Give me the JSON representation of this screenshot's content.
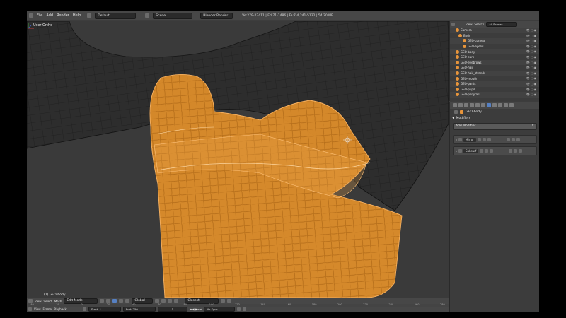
{
  "topbar": {
    "menus": [
      "File",
      "Add",
      "Render",
      "Help"
    ],
    "layout": "Default",
    "scene": "Scene",
    "engine": "Blender Render",
    "stats": "Ve:279-23411 | Ed:71-1486 | Fa:7-4,241-5132 | 54.20 MB"
  },
  "viewport": {
    "view_label": "User Ortho",
    "object_label": "(1) GEO-body",
    "header": {
      "menus": [
        "View",
        "Select",
        "Mesh"
      ],
      "mode": "Edit Mode",
      "pivot": "Global",
      "proportional": "Closest"
    }
  },
  "timeline": {
    "ruler_ticks": [
      "-40",
      "-20",
      "0",
      "20",
      "40",
      "60",
      "80",
      "100",
      "120",
      "140",
      "160",
      "180",
      "200",
      "220",
      "240",
      "260",
      "280"
    ],
    "menus": [
      "View",
      "Frame",
      "Playback"
    ],
    "start": "Start: 1",
    "end": "End: 250",
    "current": "1",
    "sync": "No Sync"
  },
  "outliner": {
    "view_label": "View",
    "search_label": "Search",
    "scenes_label": "All Scenes",
    "items": [
      {
        "label": "Camera",
        "indent": 8
      },
      {
        "label": "Body",
        "indent": 12
      },
      {
        "label": "GEO-cornea",
        "indent": 18
      },
      {
        "label": "GEO-eyelid",
        "indent": 18
      },
      {
        "label": "GEO-body",
        "indent": 8
      },
      {
        "label": "GEO-ears",
        "indent": 8
      },
      {
        "label": "GEO-eyebrows",
        "indent": 8
      },
      {
        "label": "GEO-hair",
        "indent": 8
      },
      {
        "label": "GEO-hair_strands",
        "indent": 8
      },
      {
        "label": "GEO-mouth",
        "indent": 8
      },
      {
        "label": "GEO-pants",
        "indent": 8
      },
      {
        "label": "GEO-pupil",
        "indent": 8
      },
      {
        "label": "GEO-ponytail",
        "indent": 8
      }
    ]
  },
  "properties": {
    "context_object": "GEO-body",
    "section_title": "Modifiers",
    "add_modifier_label": "Add Modifier",
    "modifiers": [
      {
        "name": "Mirror"
      },
      {
        "name": "Subsurf"
      }
    ]
  },
  "colors": {
    "accent_orange": "#e8953b",
    "mesh_fill": "#dd8d2a",
    "active_blue": "#5680c2"
  }
}
